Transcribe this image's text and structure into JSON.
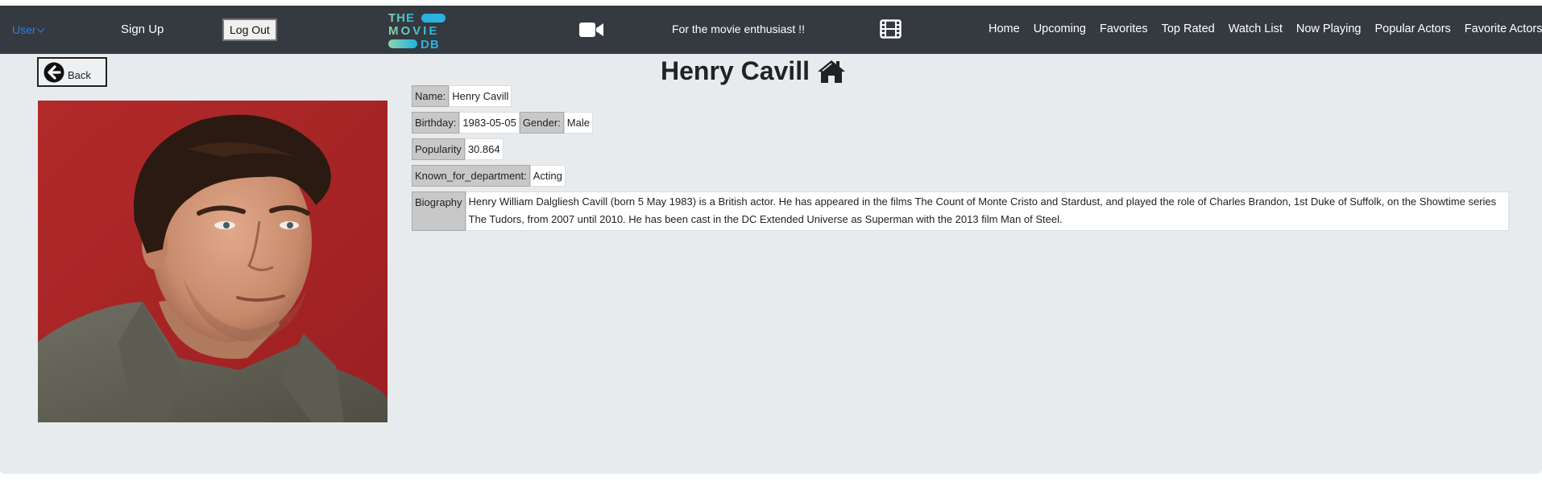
{
  "nav": {
    "user_label": "User",
    "signup_label": "Sign Up",
    "logout_label": "Log Out",
    "logo": {
      "line1": "THE",
      "line2": "MOVIE",
      "line3": "DB"
    },
    "tagline": "For the movie enthusiast !!",
    "links": [
      "Home",
      "Upcoming",
      "Favorites",
      "Top Rated",
      "Watch List",
      "Now Playing",
      "Popular Actors",
      "Favorite Actors"
    ]
  },
  "page": {
    "back_label": "Back",
    "title": "Henry Cavill"
  },
  "details": {
    "name_label": "Name:",
    "name_value": "Henry Cavill",
    "birthday_label": "Birthday:",
    "birthday_value": "1983-05-05",
    "gender_label": "Gender:",
    "gender_value": "Male",
    "popularity_label": "Popularity",
    "popularity_value": "30.864",
    "department_label": "Known_for_department:",
    "department_value": "Acting",
    "biography_label": "Biography",
    "biography_value": "Henry William Dalgliesh Cavill (born 5 May 1983) is a British actor. He has appeared in the films The Count of Monte Cristo and Stardust, and played the role of Charles Brandon, 1st Duke of Suffolk, on the Showtime series The Tudors, from 2007 until 2010. He has been cast in the DC Extended Universe as Superman with the 2013 film Man of Steel."
  },
  "colors": {
    "navbar": "#343a40",
    "main_bg": "#e8ebee",
    "user_link": "#2f7fd8",
    "logo_teal": "#5fc9a8",
    "logo_blue": "#2bb3e0"
  },
  "icons": {
    "back": "arrow-circle-left-icon",
    "home": "home-icon",
    "video": "video-camera-icon",
    "film": "film-icon"
  }
}
